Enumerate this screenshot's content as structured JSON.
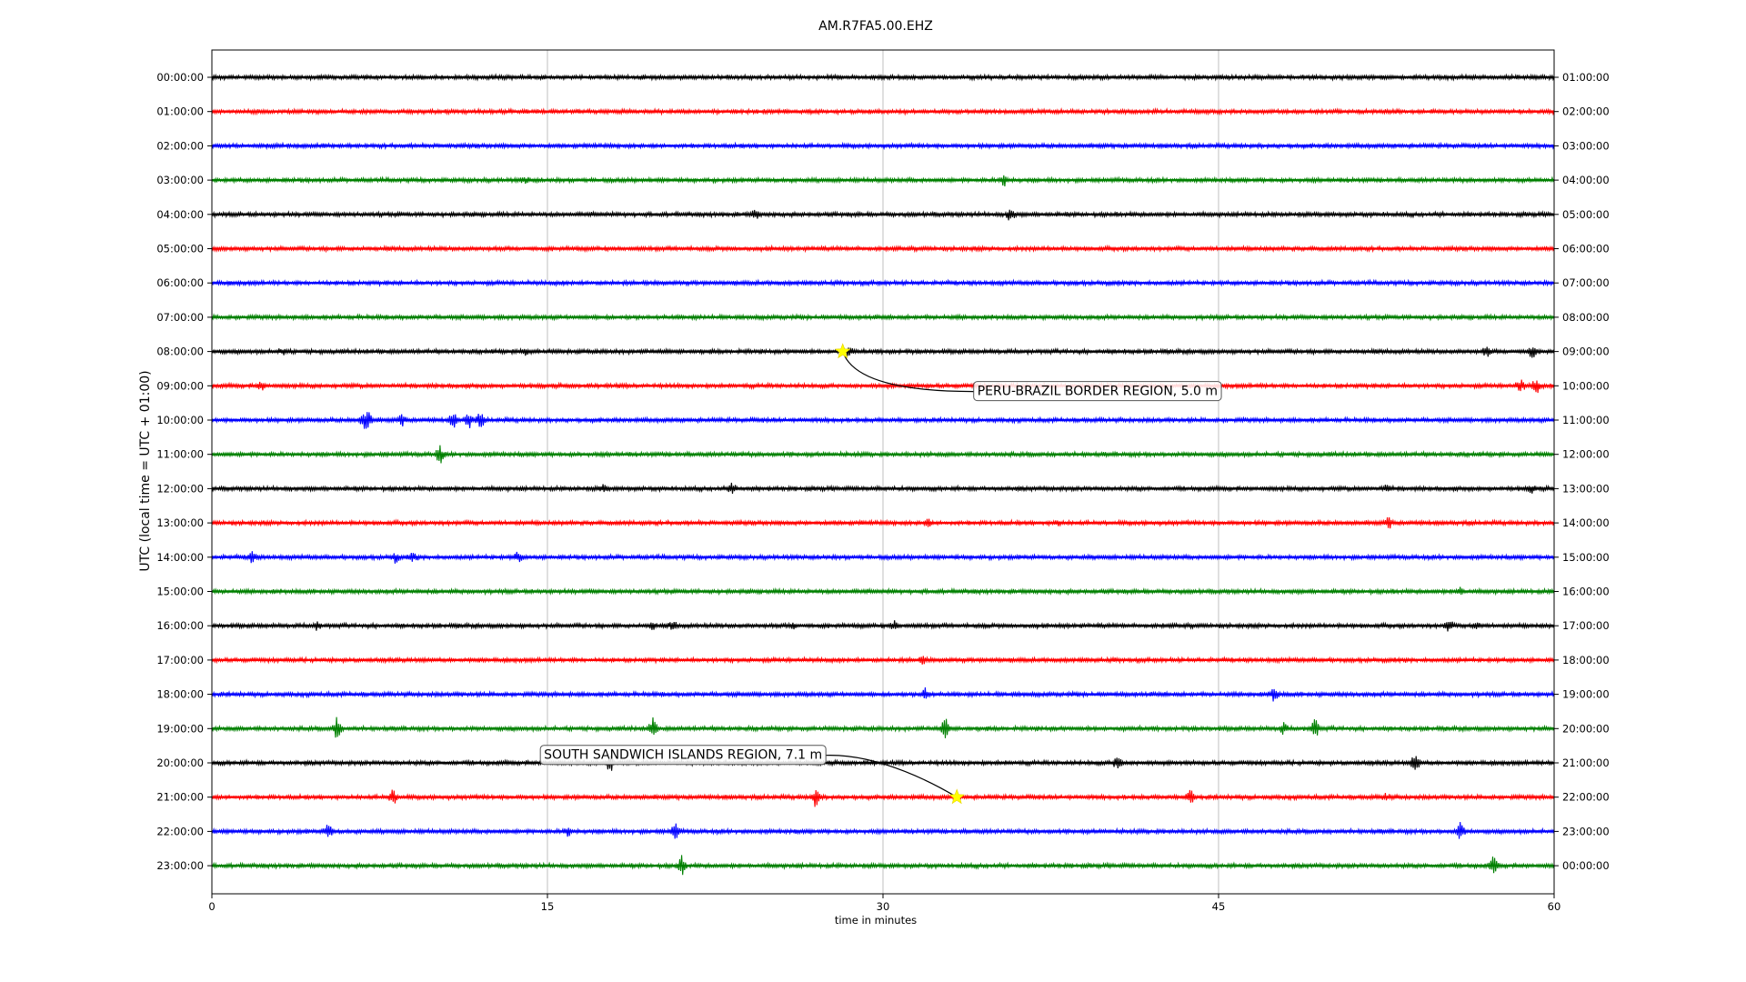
{
  "chart_data": {
    "type": "line",
    "title": "AM.R7FA5.00.EHZ",
    "xlabel": "time in minutes",
    "ylabel": "UTC (local time = UTC + 01:00)",
    "xlim": [
      0,
      60
    ],
    "x_ticks": [
      "0",
      "15",
      "30",
      "45",
      "60"
    ],
    "x_tick_values": [
      0,
      15,
      30,
      45,
      60
    ],
    "grid": "vertical",
    "trace_colors": [
      "#000000",
      "#ff0000",
      "#0000ff",
      "#008000"
    ],
    "left_labels": [
      "00:00:00",
      "01:00:00",
      "02:00:00",
      "03:00:00",
      "04:00:00",
      "05:00:00",
      "06:00:00",
      "07:00:00",
      "08:00:00",
      "09:00:00",
      "10:00:00",
      "11:00:00",
      "12:00:00",
      "13:00:00",
      "14:00:00",
      "15:00:00",
      "16:00:00",
      "17:00:00",
      "18:00:00",
      "19:00:00",
      "20:00:00",
      "21:00:00",
      "22:00:00",
      "23:00:00"
    ],
    "right_labels": [
      "01:00:00",
      "02:00:00",
      "03:00:00",
      "04:00:00",
      "05:00:00",
      "06:00:00",
      "07:00:00",
      "08:00:00",
      "09:00:00",
      "10:00:00",
      "11:00:00",
      "12:00:00",
      "13:00:00",
      "14:00:00",
      "15:00:00",
      "16:00:00",
      "17:00:00",
      "18:00:00",
      "19:00:00",
      "20:00:00",
      "21:00:00",
      "22:00:00",
      "23:00:00",
      "00:00:00"
    ],
    "spikes": [
      [],
      [],
      [],
      {
        "x": [
          35.4,
          14.0
        ],
        "a": [
          1.0,
          0.4
        ]
      },
      {
        "x": [
          24.3,
          35.7
        ],
        "a": [
          0.7,
          1.0
        ]
      },
      [],
      [],
      [],
      {
        "x": [
          3.2,
          14.0,
          28.5,
          57.0,
          59.0
        ],
        "a": [
          0.5,
          0.5,
          0.5,
          0.7,
          1.0
        ]
      },
      {
        "x": [
          2.2,
          58.5,
          59.2
        ],
        "a": [
          0.6,
          1.0,
          1.2
        ]
      },
      {
        "x": [
          6.8,
          7.0,
          8.5,
          10.8,
          11.5,
          12.0
        ],
        "a": [
          1.2,
          1.0,
          0.8,
          1.0,
          1.2,
          1.0
        ]
      },
      {
        "x": [
          10.2
        ],
        "a": [
          1.3
        ]
      },
      {
        "x": [
          17.5,
          23.3,
          52.5,
          59.0
        ],
        "a": [
          0.5,
          0.8,
          0.5,
          0.5
        ]
      },
      {
        "x": [
          32.0,
          37.8,
          52.6
        ],
        "a": [
          0.5,
          0.4,
          0.8
        ]
      },
      {
        "x": [
          1.8,
          8.2,
          9.0,
          13.7
        ],
        "a": [
          0.9,
          0.7,
          0.6,
          0.8
        ]
      },
      {
        "x": [
          55.8
        ],
        "a": [
          0.5
        ]
      },
      {
        "x": [
          4.7,
          19.7,
          20.6,
          26.0,
          30.5,
          55.3,
          56.5
        ],
        "a": [
          0.5,
          0.6,
          0.6,
          0.4,
          0.6,
          0.9,
          0.6
        ]
      },
      {
        "x": [
          31.8
        ],
        "a": [
          0.5
        ]
      },
      {
        "x": [
          31.9,
          47.5
        ],
        "a": [
          1.0,
          1.2
        ]
      },
      {
        "x": [
          5.6,
          19.7,
          32.8,
          47.9,
          49.3
        ],
        "a": [
          1.8,
          1.6,
          1.6,
          0.8,
          1.6
        ]
      },
      {
        "x": [
          17.8,
          40.5,
          53.8
        ],
        "a": [
          1.3,
          1.3,
          1.3
        ]
      },
      {
        "x": [
          8.1,
          27.0,
          43.7,
          52.5
        ],
        "a": [
          1.2,
          1.6,
          1.2,
          0.4
        ]
      },
      {
        "x": [
          5.2,
          15.9,
          20.7,
          55.8
        ],
        "a": [
          1.3,
          0.8,
          1.3,
          1.4
        ]
      },
      {
        "x": [
          21.0,
          57.3
        ],
        "a": [
          1.3,
          1.3
        ]
      }
    ],
    "annotations": [
      {
        "text": "PERU-BRAZIL BORDER REGION, 5.0 m",
        "row": 8,
        "x": 28.2
      },
      {
        "text": "SOUTH SANDWICH ISLANDS REGION, 7.1 m",
        "row": 21,
        "x": 33.3
      }
    ]
  }
}
